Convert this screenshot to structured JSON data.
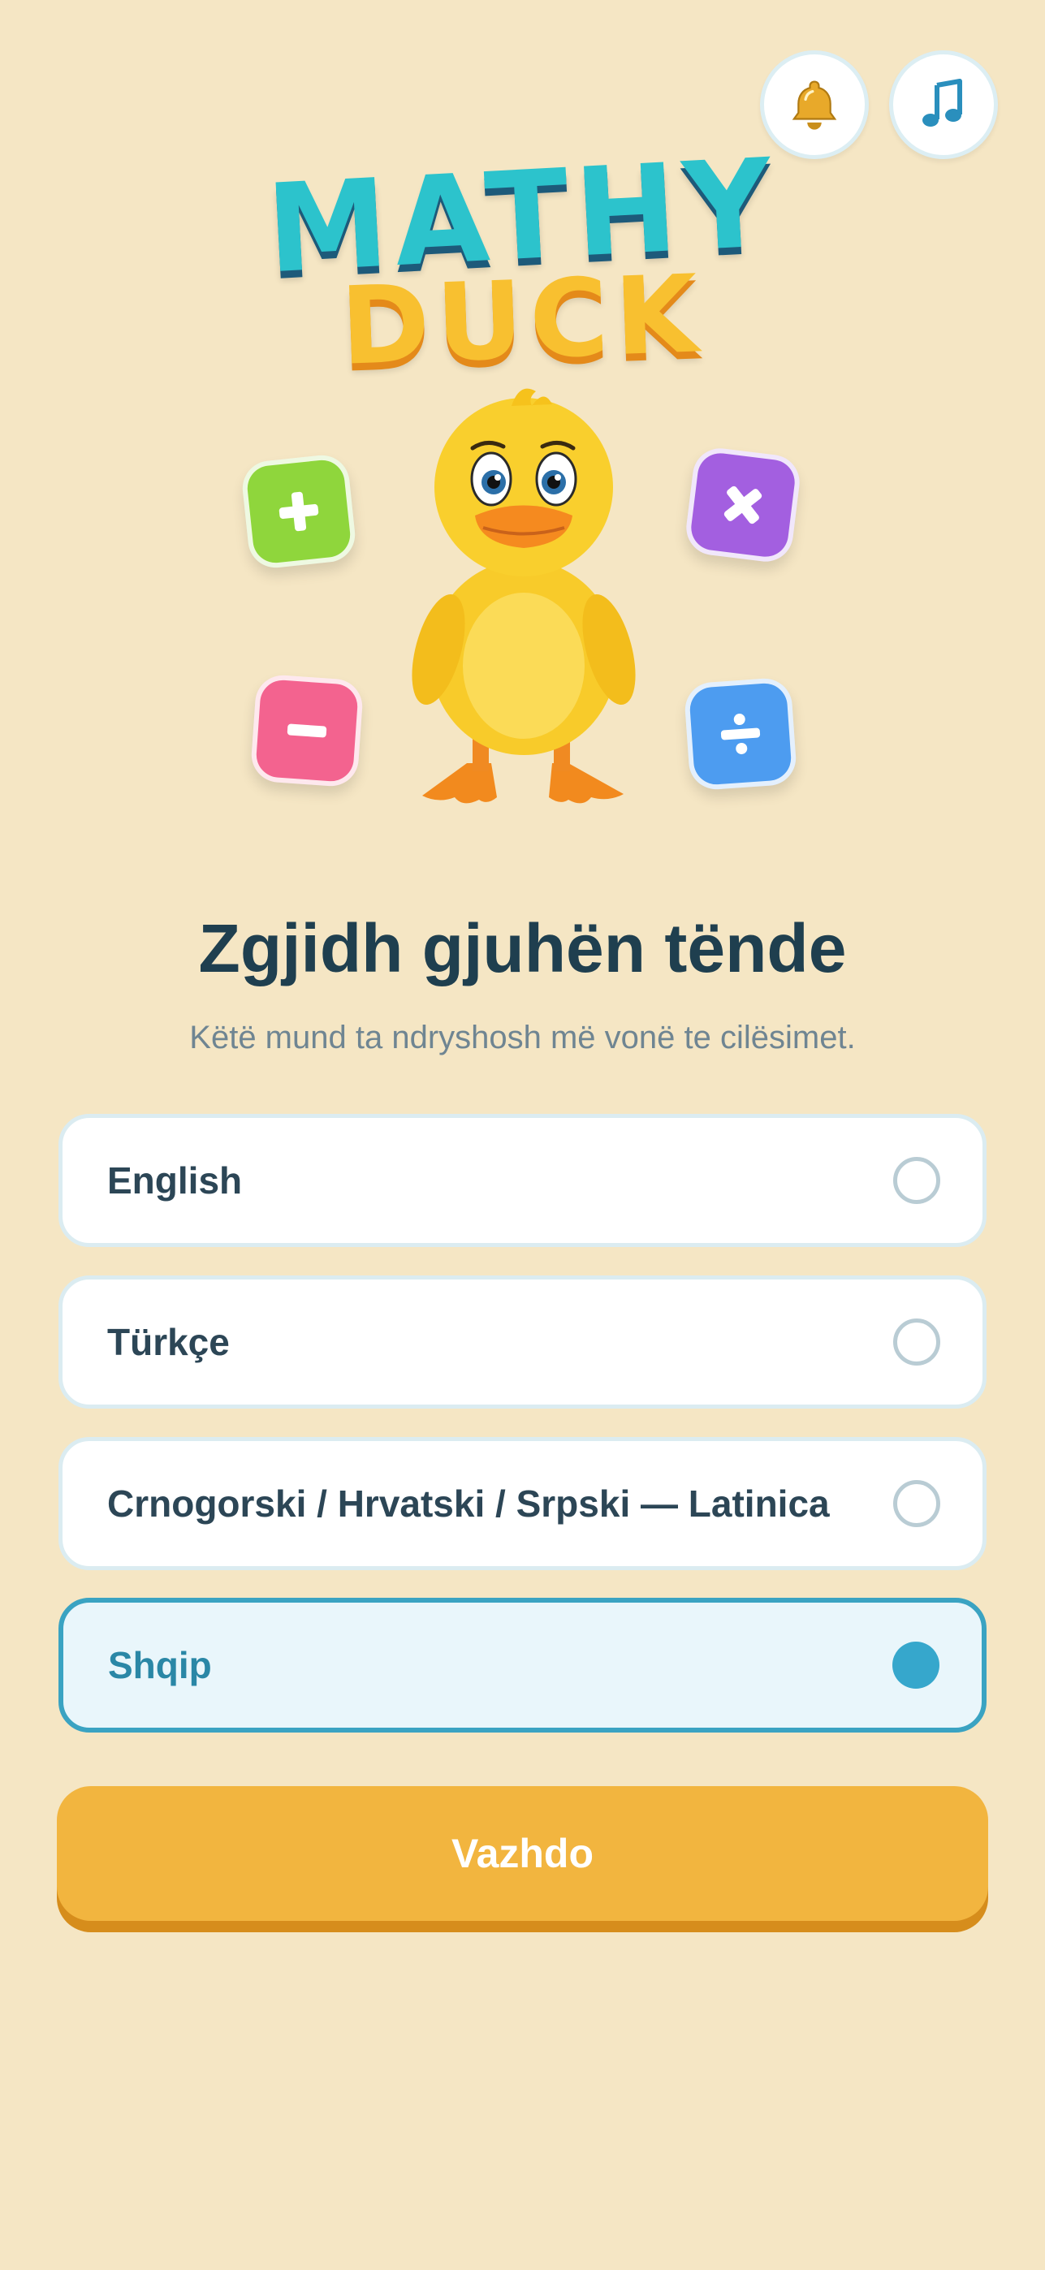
{
  "app": {
    "logo_line1": "MATHY",
    "logo_line2": "DUCK"
  },
  "header": {
    "bell_icon": "bell-icon",
    "music_icon": "music-note-icon"
  },
  "operators": [
    "plus-icon",
    "times-icon",
    "minus-icon",
    "divide-icon"
  ],
  "language_screen": {
    "title": "Zgjidh gjuhën tënde",
    "subtitle": "Këtë mund ta ndryshosh më vonë te cilësimet.",
    "options": [
      {
        "label": "English",
        "selected": false
      },
      {
        "label": "Türkçe",
        "selected": false
      },
      {
        "label": "Crnogorski / Hrvatski / Srpski — Latinica",
        "selected": false
      },
      {
        "label": "Shqip",
        "selected": true
      }
    ],
    "continue_label": "Vazhdo"
  },
  "colors": {
    "background": "#f5e6c4",
    "accent_teal": "#2cc3cc",
    "accent_yellow": "#f8c030",
    "selected_border": "#3aa3c2",
    "button": "#f2b53f"
  }
}
